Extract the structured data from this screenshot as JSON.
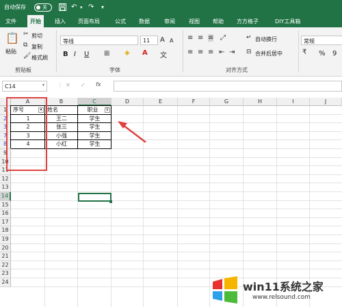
{
  "titlebar": {
    "autosave_label": "自动保存",
    "autosave_state": "关"
  },
  "tabs": [
    "文件",
    "开始",
    "插入",
    "页面布局",
    "公式",
    "数据",
    "审阅",
    "视图",
    "帮助",
    "方方格子",
    "DIY工具箱"
  ],
  "ribbon": {
    "paste": "粘贴",
    "cut": "剪切",
    "copy": "复制",
    "format_painter": "格式刷",
    "clipboard_group": "剪贴板",
    "font_name": "等线",
    "font_size": "11",
    "font_grow": "A",
    "font_shrink": "A",
    "bold": "B",
    "italic": "I",
    "underline": "U",
    "font_group": "字体",
    "wrap_text": "自动换行",
    "merge_center": "合并后居中",
    "align_group": "对齐方式",
    "number_format": "常规",
    "percent": "%",
    "comma": "9"
  },
  "formula_bar": {
    "name_box": "C14",
    "fx": "fx",
    "cancel": "✕",
    "enter": "✓"
  },
  "columns": [
    "A",
    "B",
    "C",
    "D",
    "E",
    "F",
    "G",
    "H",
    "I",
    "J"
  ],
  "rows": [
    "1",
    "2",
    "3",
    "7",
    "8",
    "9",
    "10",
    "11",
    "12",
    "13",
    "14",
    "15",
    "16",
    "17",
    "18",
    "19",
    "20",
    "21",
    "22",
    "23",
    "24"
  ],
  "table": {
    "headers": [
      "序号",
      "姓名",
      "职业"
    ],
    "data": [
      [
        "1",
        "王二",
        "学生"
      ],
      [
        "2",
        "张三",
        "学生"
      ],
      [
        "3",
        "小强",
        "学生"
      ],
      [
        "4",
        "小红",
        "学生"
      ]
    ]
  },
  "watermark": {
    "brand": "win11系统之家",
    "url": "www.relsound.com"
  },
  "colors": {
    "accent": "#217346",
    "annotation": "#e04040",
    "filtered_row_header": "#2e4fbd"
  }
}
